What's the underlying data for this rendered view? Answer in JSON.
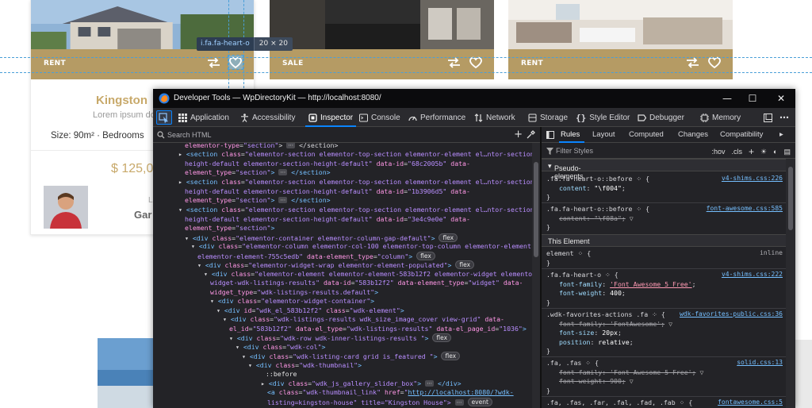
{
  "website": {
    "cards": [
      {
        "tag": "RENT",
        "title": "Kingston",
        "desc": "Lorem ipsum dolor sit a",
        "size_meta": "Size: 90m²  ·  Bedrooms",
        "price": "$ 125,0",
        "agent_label": "L",
        "agent_name": "Gar"
      },
      {
        "tag": "SALE"
      },
      {
        "tag": "RENT"
      }
    ],
    "tooltip": {
      "selector": "i.fa.fa-heart-o",
      "dims": "20 × 20"
    }
  },
  "devtools": {
    "window_title": "Developer Tools — WpDirectoryKit — http://localhost:8080/",
    "tabs": [
      "Application",
      "Accessibility",
      "Inspector",
      "Console",
      "Performance",
      "Network",
      "Storage",
      "Style Editor",
      "Debugger",
      "Memory"
    ],
    "active_tab": "Inspector",
    "search_placeholder": "Search HTML",
    "right_tabs": [
      "Rules",
      "Layout",
      "Computed",
      "Changes",
      "Compatibility"
    ],
    "filter_placeholder": "Filter Styles",
    "filter_tools": [
      ":hov",
      ".cls"
    ],
    "sections": {
      "pseudo": "Pseudo-elements",
      "this": "This Element"
    },
    "rules": {
      "r1": {
        "selector": ".fa.fa-heart-o::before",
        "source": "v4-shims.css:226",
        "prop": "content",
        "value": "\"\\f004\""
      },
      "r2": {
        "selector": ".fa.fa-heart-o::before",
        "source": "font-awesome.css:585",
        "prop": "content",
        "value": "\"\\f08a\""
      },
      "r3": {
        "selector": "element",
        "source": "inline"
      },
      "r4": {
        "selector": ".fa.fa-heart-o",
        "source": "v4-shims.css:222",
        "p1": "font-family",
        "v1": "'Font Awesome 5 Free'",
        "p2": "font-weight",
        "v2": "400"
      },
      "r5": {
        "selector": ".wdk-favorites-actions .fa",
        "source": "wdk-favorites-public.css:36",
        "p1": "font-family",
        "v1": "'FontAwesome'",
        "p2": "font-size",
        "v2": "20px",
        "p3": "position",
        "v3": "relative"
      },
      "r6": {
        "selector": ".fa, .fas",
        "source": "solid.css:13",
        "p1": "font-family",
        "v1": "'Font Awesome 5 Free'",
        "p2": "font-weight",
        "v2": "900"
      },
      "r7": {
        "selector": ".fa, .fas, .far, .fal, .fad, .fab",
        "source": "fontawesome.css:5"
      }
    },
    "tree": {
      "l1_tail": "elementor-type=\"section\"",
      "sec1": {
        "cls1": "elementor-section elementor-top-section elementor-element el…ntor-section-",
        "cls2": "height-default elementor-section-height-default",
        "id": "68c2005b",
        "etype": "section"
      },
      "sec2": {
        "cls1": "elementor-section elementor-top-section elementor-element el…ntor-section-",
        "cls2": "height-default elementor-section-height-default",
        "id": "1b3906d5",
        "etype": "section"
      },
      "sec3": {
        "cls1": "elementor-section elementor-top-section elementor-element el…ntor-section-",
        "cls2": "height-default elementor-section-height-default",
        "id": "3e4c9e0e",
        "etype": "section"
      },
      "container": "elementor-container elementor-column-gap-default",
      "column": {
        "cls1": "elementor-column elementor-col-100 elementor-top-column elementor-element",
        "cls2": "elementor-element-755c5edb",
        "etype": "column"
      },
      "widget_wrap": "elementor-widget-wrap elementor-element-populated",
      "widget": {
        "cls1": "elementor-element elementor-element-583b12f2 elementor-widget elementor-",
        "cls2": "widget-wdk-listings-results",
        "id": "583b12f2",
        "etype": "widget",
        "wtype": "wdk-listings-results.default"
      },
      "widget_container": "elementor-widget-container",
      "wdk_el": {
        "id": "wdk_el_583b12f2",
        "cls": "wdk-element"
      },
      "results": {
        "cls": "wdk-listings-results wdk_size_image_cover view-grid",
        "elid": "583b12f2",
        "eltype": "wdk-listings-results",
        "page": "1036"
      },
      "row": "wdk-row wdk-inner-listings-results ",
      "col": "wdk-col",
      "card": "wdk-listing-card grid is_featured ",
      "thumb": "wdk-thumbnail",
      "before": "::before",
      "slider": "wdk_js_gallery_slider_box",
      "link": {
        "cls": "wdk-thumbnail_link",
        "href": "http://localhost:8080/?wdk-",
        "tail": "listing=kingston-house\" title=\"Kingston House\">"
      },
      "badges": {
        "flex": "flex",
        "event": "event"
      }
    }
  },
  "colors": {
    "accent": "#0a84ff",
    "gold": "#b59b64",
    "price": "#c8a96a"
  }
}
